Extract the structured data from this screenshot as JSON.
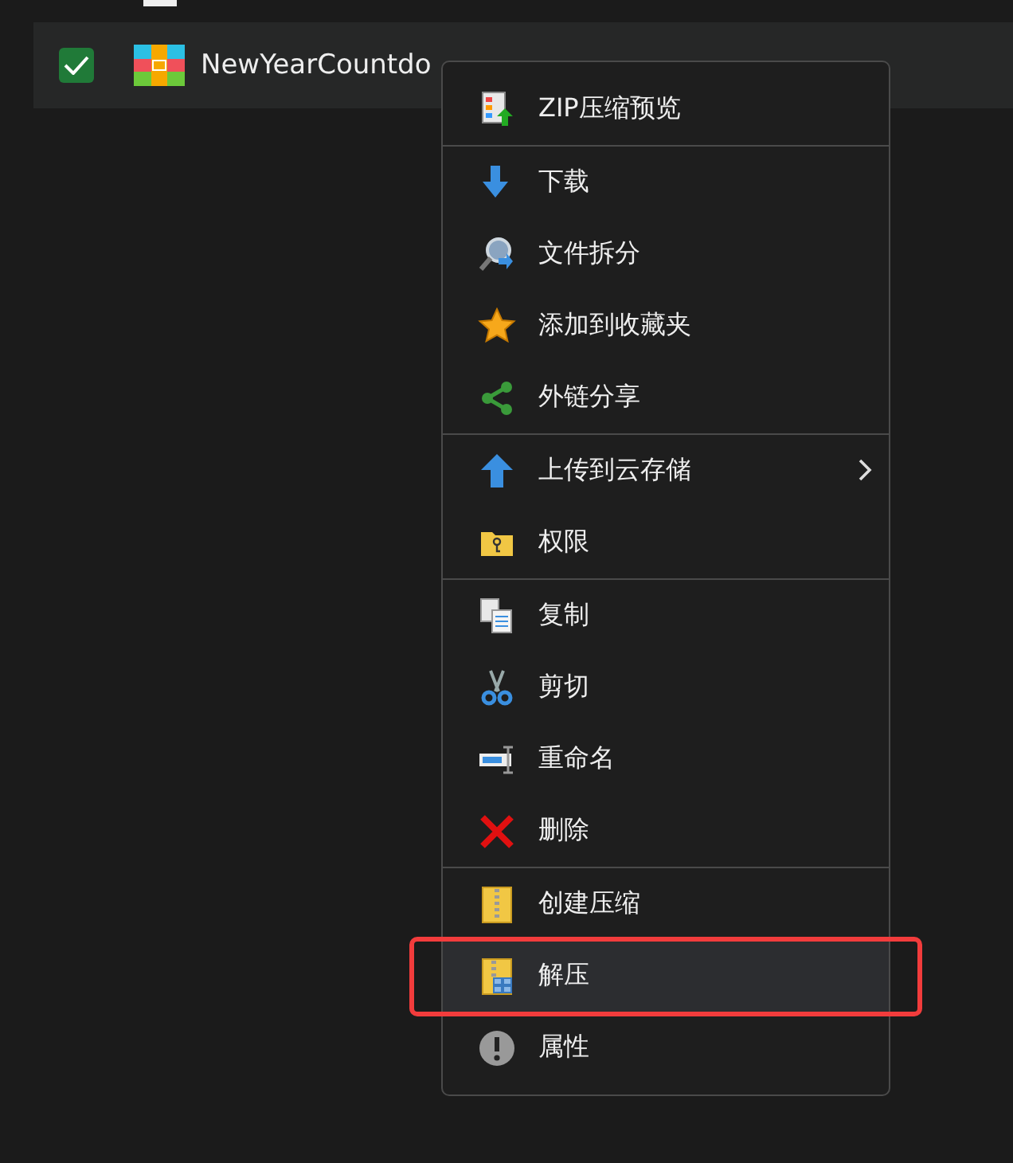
{
  "file_row": {
    "checked": true,
    "name": "NewYearCountdo"
  },
  "context_menu": {
    "groups": [
      [
        {
          "label": "ZIP压缩预览",
          "kind": "zip-preview",
          "submenu": false,
          "selected": false,
          "annotated": false
        }
      ],
      [
        {
          "label": "下载",
          "kind": "download",
          "submenu": false,
          "selected": false,
          "annotated": false
        },
        {
          "label": "文件拆分",
          "kind": "magnifier",
          "submenu": false,
          "selected": false,
          "annotated": false
        },
        {
          "label": "添加到收藏夹",
          "kind": "star",
          "submenu": false,
          "selected": false,
          "annotated": false
        },
        {
          "label": "外链分享",
          "kind": "share",
          "submenu": false,
          "selected": false,
          "annotated": false
        }
      ],
      [
        {
          "label": "上传到云存储",
          "kind": "upload",
          "submenu": true,
          "selected": false,
          "annotated": false
        },
        {
          "label": "权限",
          "kind": "key-folder",
          "submenu": false,
          "selected": false,
          "annotated": false
        }
      ],
      [
        {
          "label": "复制",
          "kind": "copy",
          "submenu": false,
          "selected": false,
          "annotated": false
        },
        {
          "label": "剪切",
          "kind": "cut",
          "submenu": false,
          "selected": false,
          "annotated": false
        },
        {
          "label": "重命名",
          "kind": "rename",
          "submenu": false,
          "selected": false,
          "annotated": false
        },
        {
          "label": "删除",
          "kind": "delete",
          "submenu": false,
          "selected": false,
          "annotated": false
        }
      ],
      [
        {
          "label": "创建压缩",
          "kind": "archive",
          "submenu": false,
          "selected": false,
          "annotated": false
        },
        {
          "label": "解压",
          "kind": "extract",
          "submenu": false,
          "selected": true,
          "annotated": true
        },
        {
          "label": "属性",
          "kind": "info",
          "submenu": false,
          "selected": false,
          "annotated": false
        }
      ]
    ]
  }
}
